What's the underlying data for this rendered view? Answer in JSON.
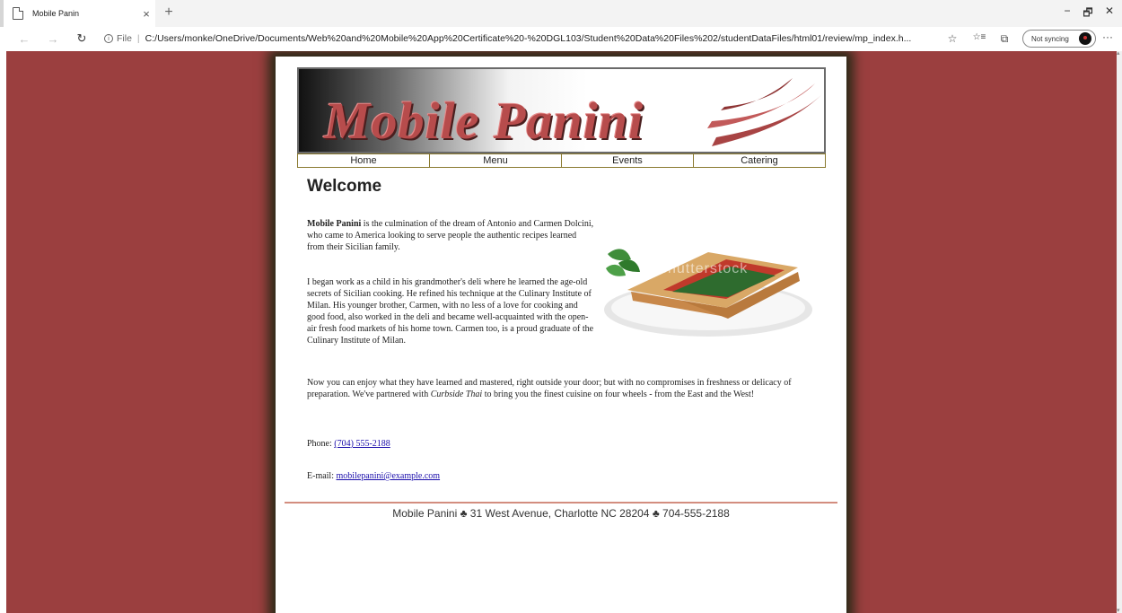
{
  "browser": {
    "tab_title": "Mobile Panin",
    "tab_close": "×",
    "new_tab": "+",
    "nav_back": "←",
    "nav_forward": "→",
    "refresh": "↻",
    "info": "i",
    "file_label": "File",
    "separator": "|",
    "url": "C:/Users/monke/OneDrive/Documents/Web%20and%20Mobile%20App%20Certificate%20-%20DGL103/Student%20Data%20Files%202/studentDataFiles/html01/review/mp_index.h...",
    "favorite": "☆",
    "favorites_list": "☆≡",
    "collections": "⧉",
    "sync_label": "Not syncing",
    "more": "···",
    "minimize": "−",
    "restore": "🗗",
    "close": "✕"
  },
  "site": {
    "logo_text": "Mobile Panini",
    "nav": [
      "Home",
      "Menu",
      "Events",
      "Catering"
    ],
    "heading": "Welcome",
    "p1_bold": "Mobile Panini",
    "p1_rest": " is the culmination of the dream of Antonio and Carmen Dolcini, who came to America looking to serve people the authentic recipes learned from their Sicilian family.",
    "p2": "I began work as a child in his grandmother's deli where he learned the age-old secrets of Sicilian cooking. He refined his technique at the Culinary Institute of Milan. His younger brother, Carmen, with no less of a love for cooking and good food, also worked in the deli and became well-acquainted with the open-air fresh food markets of his home town. Carmen too, is a proud graduate of the Culinary Institute of Milan.",
    "p3_start": "Now you can enjoy what they have learned and mastered, right outside your door; but with no compromises in freshness or delicacy of preparation. We've partnered with ",
    "p3_italic": "Curbside Thai",
    "p3_end": " to bring you the finest cuisine on four wheels - from the East and the West!",
    "phone_label": "Phone: ",
    "phone_value": "(704) 555-2188",
    "email_label": "E-mail: ",
    "email_value": "mobilepanini@example.com",
    "watermark": "shutterstock",
    "footer": "Mobile Panini ♣ 31 West Avenue, Charlotte NC   28204 ♣ 704-555-2188"
  },
  "colors": {
    "background": "#9b3f3f",
    "logo_red": "#b74c4c",
    "nav_border": "#8a7a30",
    "divider": "#d38d7f"
  }
}
